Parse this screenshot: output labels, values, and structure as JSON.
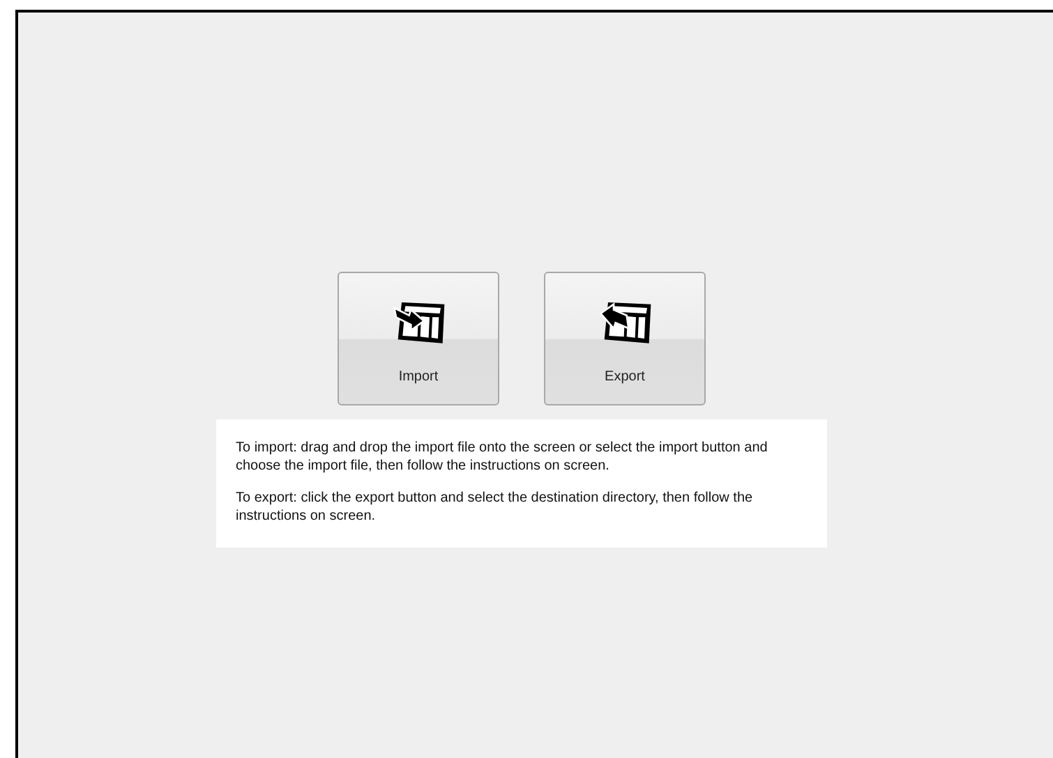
{
  "buttons": [
    {
      "label": "Import",
      "kind": "import"
    },
    {
      "label": "Export",
      "kind": "export"
    }
  ],
  "instructions": [
    "To import: drag and drop the import file onto the screen or select the import button and choose the import file, then follow the instructions on screen.",
    "To export: click the export button and select the destination directory, then follow the instructions on screen."
  ]
}
